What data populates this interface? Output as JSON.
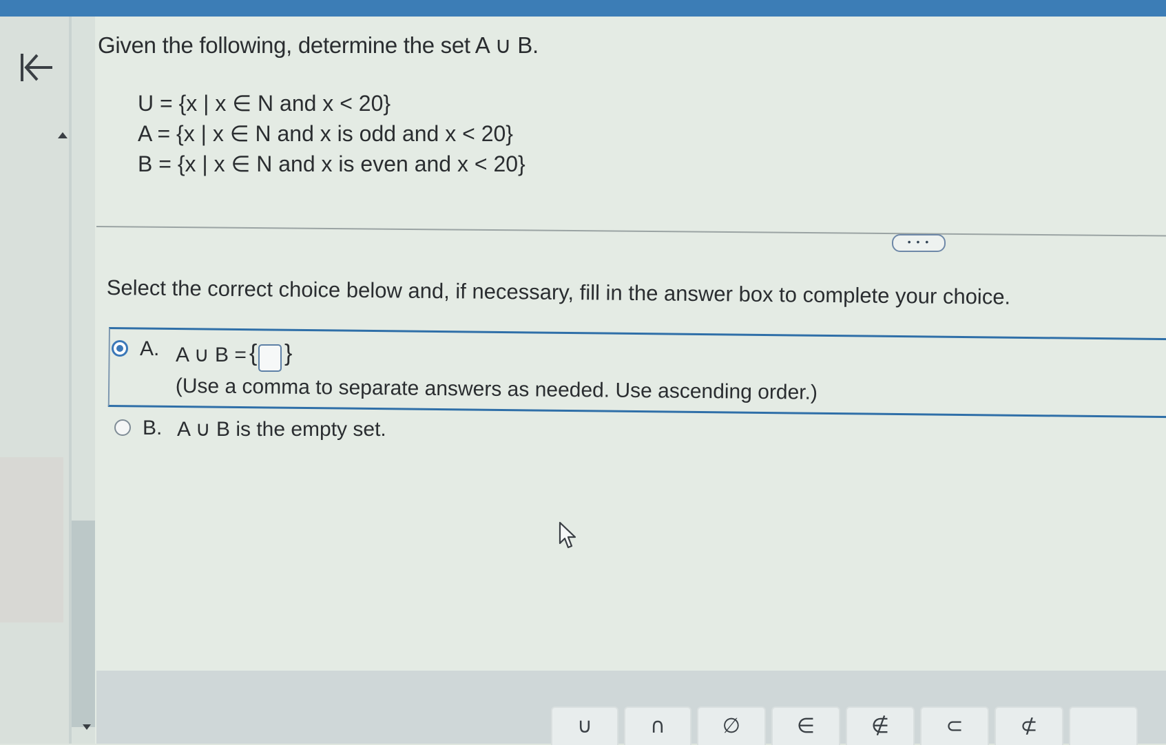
{
  "question": {
    "prompt": "Given the following, determine the set A ∪ B.",
    "universal_set": "U = {x | x ∈ N and x < 20}",
    "set_a": "A = {x | x ∈ N and x is odd and x < 20}",
    "set_b": "B = {x | x ∈ N and x is even and x < 20}"
  },
  "more_button_label": "• • •",
  "instruction": "Select the correct choice below and, if necessary, fill in the answer box to complete your choice.",
  "choices": {
    "a": {
      "letter": "A.",
      "expression": "A ∪ B =",
      "brace_open": "{",
      "brace_close": "}",
      "answer_value": "",
      "hint": "(Use a comma to separate answers as needed. Use ascending order.)",
      "selected": true
    },
    "b": {
      "letter": "B.",
      "text": "A ∪ B is the empty set.",
      "selected": false
    }
  },
  "toolbar": {
    "symbols": [
      "∪",
      "∩",
      "∅",
      "∈",
      "∉",
      "⊂",
      "⊄"
    ]
  },
  "colors": {
    "accent": "#3b78b8",
    "top_bar": "#3c7db6",
    "background": "#e4ebe4"
  },
  "icons": {
    "back": "back-to-start-icon",
    "cursor": "mouse-pointer-icon"
  }
}
